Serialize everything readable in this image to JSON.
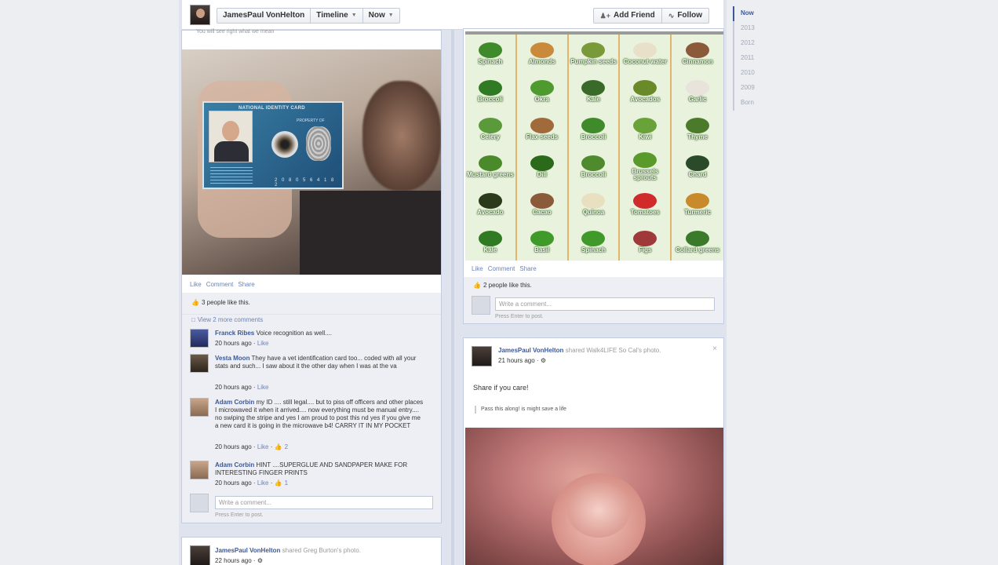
{
  "topbar": {
    "profile_name": "JamesPaul VonHelton",
    "timeline_label": "Timeline",
    "now_label": "Now",
    "add_friend_label": "Add Friend",
    "follow_label": "Follow"
  },
  "scrubber": [
    "Now",
    "2013",
    "2012",
    "2011",
    "2010",
    "2009",
    "Born"
  ],
  "post_left": {
    "caption": "You will see right what we mean",
    "idcard": {
      "title": "NATIONAL IDENTITY CARD",
      "subtitle": "PROPERTY OF",
      "number": "2 0 8 0 5 6 4 1 8 2"
    },
    "actions": [
      "Like",
      "Comment",
      "Share"
    ],
    "likes": "3 people like this.",
    "view_more": "View 2 more comments",
    "comments": [
      {
        "name": "Franck Ribes",
        "text": "Voice recognition as well....",
        "time": "20 hours ago",
        "like": "Like",
        "count": ""
      },
      {
        "name": "Vesta Moon",
        "text": "They have a vet identification card too... coded with all your stats and such... I saw about it the other day when I was at the va",
        "time": "20 hours ago",
        "like": "Like",
        "count": ""
      },
      {
        "name": "Adam Corbin",
        "text": "my ID .... still legal.... but to piss off officers and other places I microwaved it when it arrived.... now everything must be manual entry.... no swiping the stripe and yes I am proud to post this nd yes if you give me a new card it is going in the microwave b4! CARRY IT IN MY POCKET",
        "time": "20 hours ago",
        "like": "Like",
        "count": "2"
      },
      {
        "name": "Adam Corbin",
        "text": "HINT ....SUPERGLUE AND SANDPAPER MAKE FOR INTERESTING FINGER PRINTS",
        "time": "20 hours ago",
        "like": "Like",
        "count": "1"
      }
    ],
    "write_placeholder": "Write a comment...",
    "enter_hint": "Press Enter to post."
  },
  "post_right_top": {
    "vegetables": [
      "Spinach",
      "Almonds",
      "Pumpkin seeds",
      "Coconut water",
      "Cinnamon",
      "Broccoli",
      "Okra",
      "Kale",
      "Avocados",
      "Garlic",
      "Celery",
      "Flax seeds",
      "Broccoli",
      "Kiwi",
      "Thyme",
      "Mustard greens",
      "Dill",
      "Broccoli",
      "Brussels sprouts",
      "Chard",
      "Avocado",
      "Cacao",
      "Quinoa",
      "Tomatoes",
      "Turmeric",
      "Kale",
      "Basil",
      "Spinach",
      "Figs",
      "Collard greens"
    ],
    "actions": [
      "Like",
      "Comment",
      "Share"
    ],
    "likes": "2 people like this.",
    "write_placeholder": "Write a comment...",
    "enter_hint": "Press Enter to post."
  },
  "post_right_bottom": {
    "author": "JamesPaul VonHelton",
    "shared_text": "shared Walk4LIFE So Cal's photo.",
    "time": "21 hours ago",
    "share_line": "Share if you care!",
    "quote": "Pass this along! is might save a life"
  },
  "post_bottom_left": {
    "author": "JamesPaul VonHelton",
    "shared_text": "shared Greg Burton's photo.",
    "time": "22 hours ago"
  },
  "colors": {
    "facebook_blue": "#3b5998",
    "link_blue": "#6d84b4",
    "ufi_bg": "#edeff4"
  }
}
